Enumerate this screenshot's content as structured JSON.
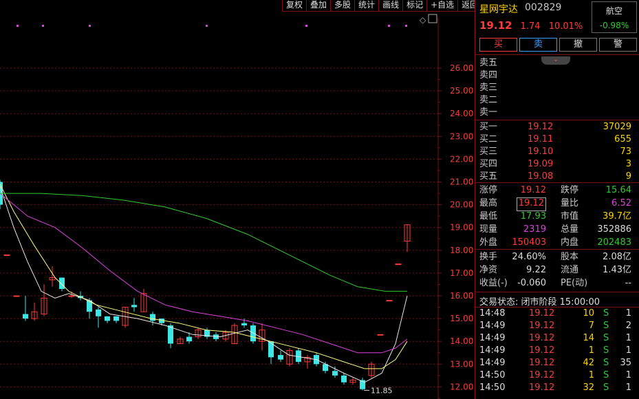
{
  "toolbar": [
    "复权",
    "叠加",
    "多股",
    "统计",
    "画线",
    "标记",
    "+自选",
    "返回"
  ],
  "stock": {
    "name": "星网宇达",
    "code": "002829",
    "price": "19.12",
    "change": "1.74",
    "pct": "10.01%"
  },
  "index": {
    "name": "航空",
    "pct": "-0.98%"
  },
  "actions": [
    "买",
    "卖",
    "撤",
    "警"
  ],
  "sell_levels": [
    "卖五",
    "卖四",
    "卖三",
    "卖二",
    "卖一"
  ],
  "buy_levels": [
    {
      "label": "买一",
      "price": "19.12",
      "vol": "37029"
    },
    {
      "label": "买二",
      "price": "19.11",
      "vol": "655"
    },
    {
      "label": "买三",
      "price": "19.10",
      "vol": "73"
    },
    {
      "label": "买四",
      "price": "19.09",
      "vol": "3"
    },
    {
      "label": "买五",
      "price": "19.08",
      "vol": "9"
    }
  ],
  "stats": [
    {
      "l1": "涨停",
      "v1": "19.12",
      "l2": "跌停",
      "v2": "15.64"
    },
    {
      "l1": "最高",
      "v1": "19.12",
      "l2": "量比",
      "v2": "6.52"
    },
    {
      "l1": "最低",
      "v1": "17.93",
      "l2": "市值",
      "v2": "39.7亿"
    },
    {
      "l1": "现量",
      "v1": "2319",
      "l2": "总量",
      "v2": "352886"
    },
    {
      "l1": "外盘",
      "v1": "150403",
      "l2": "内盘",
      "v2": "202483"
    }
  ],
  "fund": [
    {
      "l1": "换手",
      "v1": "24.60%",
      "l2": "股本",
      "v2": "2.08亿"
    },
    {
      "l1": "净资",
      "v1": "9.22",
      "l2": "流通",
      "v2": "1.43亿"
    },
    {
      "l1": "收益(-)",
      "v1": "-0.060",
      "l2": "PE(动)",
      "v2": "--"
    }
  ],
  "status": "交易状态: 闭市阶段 15:00:00",
  "ticks": [
    {
      "t": "14:48",
      "p": "19.12",
      "v": "10",
      "s": "S",
      "n": "1"
    },
    {
      "t": "14:49",
      "p": "19.12",
      "v": "7",
      "s": "S",
      "n": "2"
    },
    {
      "t": "14:49",
      "p": "19.12",
      "v": "14",
      "s": "S",
      "n": "1"
    },
    {
      "t": "14:49",
      "p": "19.12",
      "v": "1",
      "s": "S",
      "n": "1"
    },
    {
      "t": "14:49",
      "p": "19.12",
      "v": "42",
      "s": "S",
      "n": "35"
    },
    {
      "t": "14:50",
      "p": "19.12",
      "v": "1",
      "s": "S",
      "n": "1"
    },
    {
      "t": "14:50",
      "p": "19.12",
      "v": "32",
      "s": "S",
      "n": "1"
    }
  ],
  "chart": {
    "yticks": [
      "26.00",
      "25.00",
      "24.00",
      "23.00",
      "22.00",
      "21.00",
      "20.00",
      "19.00",
      "18.00",
      "17.00",
      "16.00",
      "15.00",
      "14.00",
      "13.00",
      "12.00"
    ],
    "low_label": "11.85",
    "colors": {
      "up": "#ff3b3b",
      "down": "#3fe6e6",
      "ma5": "#e8e8e8",
      "ma10": "#ffff80",
      "ma20": "#e040e0",
      "ma60": "#2ecc2e",
      "grid": "#7a1010"
    }
  }
}
